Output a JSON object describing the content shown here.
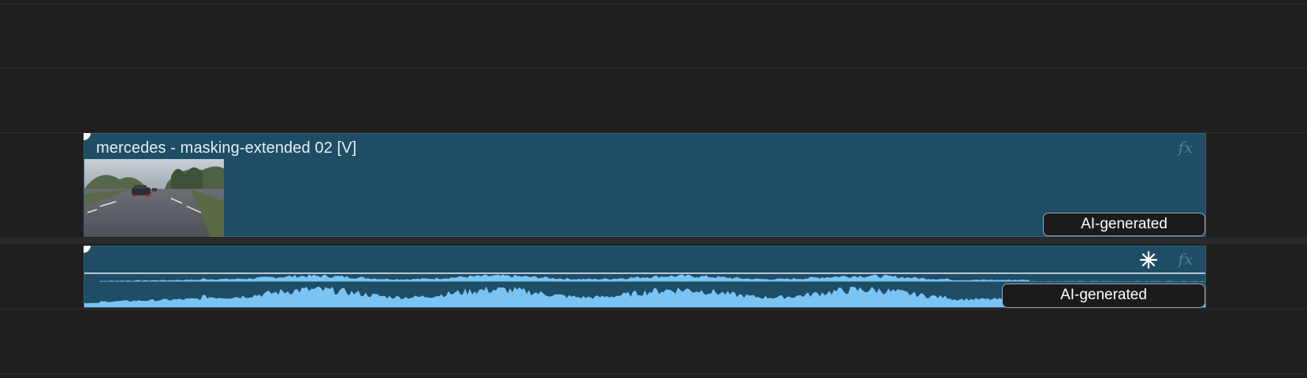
{
  "timeline": {
    "video_clip": {
      "title": "mercedes - masking-extended 02 [V]",
      "badge": "AI-generated",
      "fx_label": "fx"
    },
    "audio_clip": {
      "badge": "AI-generated",
      "fx_label": "fx",
      "icons": [
        "spark-icon",
        "fx-icon"
      ]
    }
  },
  "colors": {
    "background": "#1f1f1f",
    "clip": "#1f4d66",
    "waveform": "#79c3f5",
    "badge_bg": "#1b1b1b"
  }
}
